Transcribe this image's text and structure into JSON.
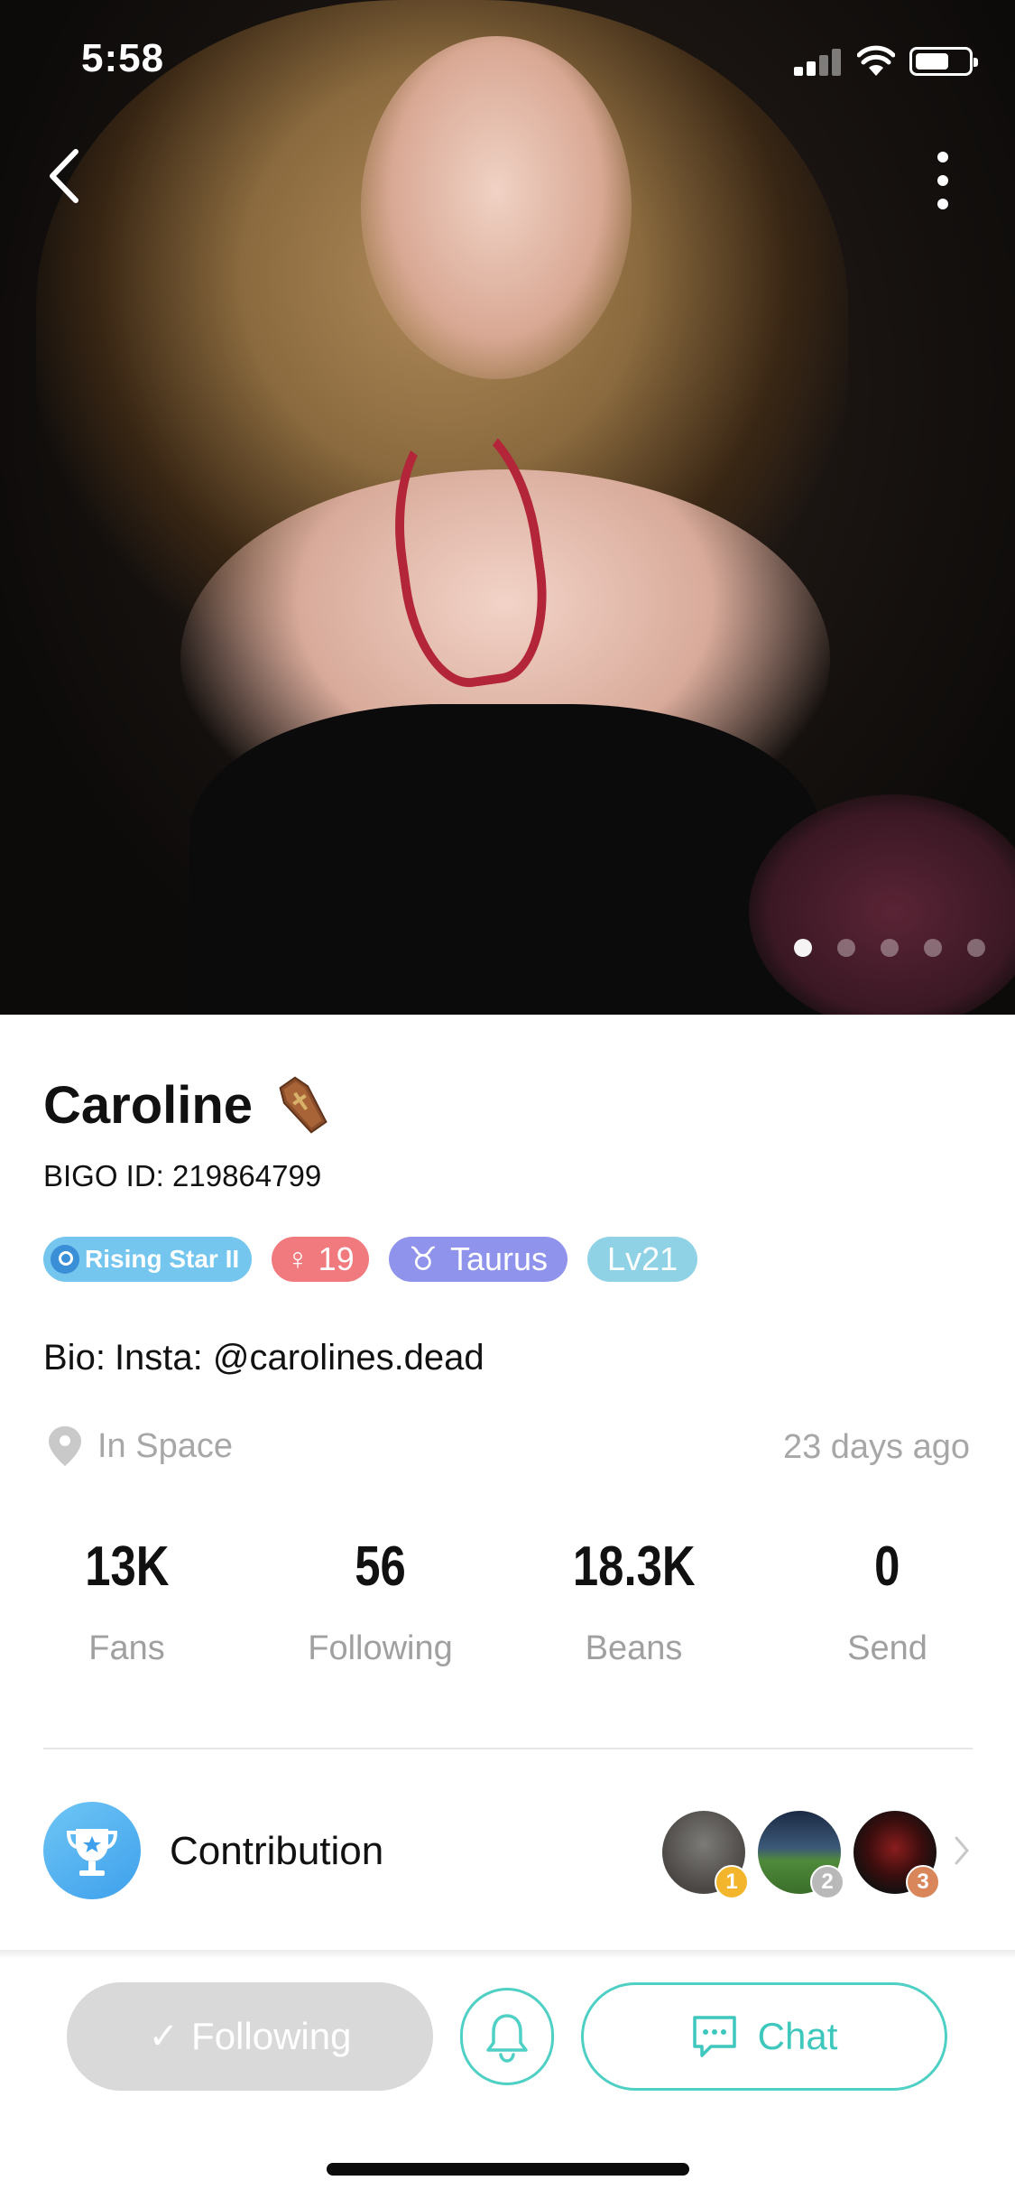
{
  "status_bar": {
    "time": "5:58"
  },
  "profile": {
    "name": "Caroline",
    "name_emoji_icon": "coffin-icon",
    "bigo_id": "BIGO ID: 219864799",
    "badges": {
      "rising_star": "Rising Star II",
      "gender_age": "19",
      "zodiac_symbol": "♉",
      "zodiac": "Taurus",
      "level": "Lv21"
    },
    "bio_label": "Bio:",
    "bio": "Insta: @carolines.dead",
    "location": "In Space",
    "last_seen": "23 days ago"
  },
  "photo_carousel": {
    "count": 5,
    "active_index": 0
  },
  "stats": [
    {
      "value": "13K",
      "label": "Fans"
    },
    {
      "value": "56",
      "label": "Following"
    },
    {
      "value": "18.3K",
      "label": "Beans"
    },
    {
      "value": "0",
      "label": "Send"
    }
  ],
  "contribution": {
    "label": "Contribution",
    "ranks": [
      "1",
      "2",
      "3"
    ],
    "rank_colors": [
      "#f3b52c",
      "#b9b9b9",
      "#d9875a"
    ]
  },
  "actions": {
    "following_label": "Following",
    "chat_label": "Chat"
  },
  "colors": {
    "accent": "#4fd0c5",
    "following_bg": "#d9d9d9",
    "muted_text": "#a7a7a7"
  }
}
